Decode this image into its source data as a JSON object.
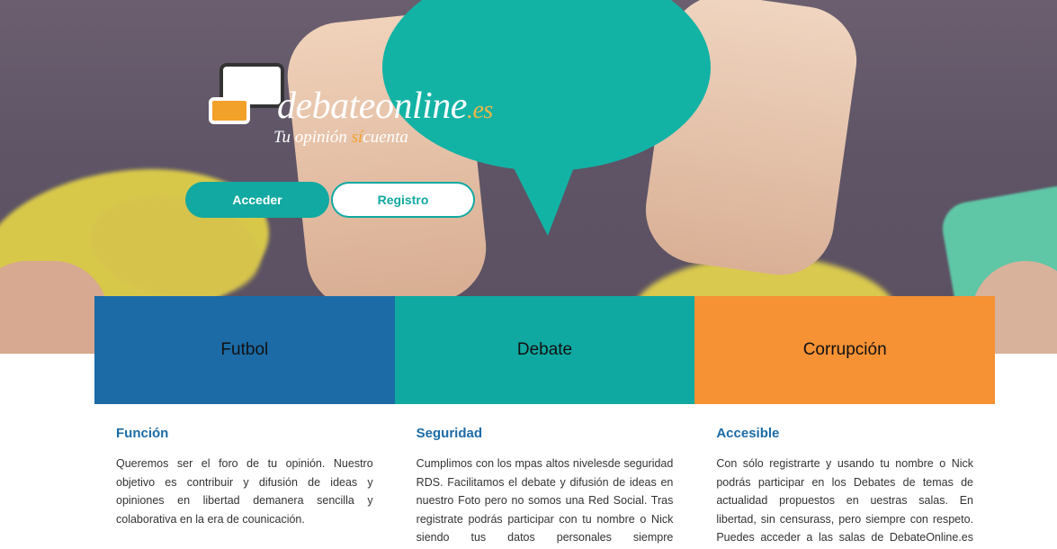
{
  "brand": {
    "name": "debateonline",
    "tld": ".es",
    "tagline_part1": "Tu opinión ",
    "tagline_highlight": "sí",
    "tagline_part2": "cuenta"
  },
  "hero_buttons": {
    "login_label": "Acceder",
    "register_label": "Registro"
  },
  "categories": [
    {
      "label": "Futbol",
      "color": "#1c6ba7"
    },
    {
      "label": "Debate",
      "color": "#0fa9a1"
    },
    {
      "label": "Corrupción",
      "color": "#f69134"
    }
  ],
  "features": [
    {
      "title": "Función",
      "text": "Queremos ser el foro de tu opinión. Nuestro objetivo es contribuir y difusión de ideas y opiniones en libertad demanera sencilla y colaborativa en la era de counicación."
    },
    {
      "title": "Seguridad",
      "text": "Cumplimos con los mpas altos nivelesde seguridad RDS. Facilitamos el debate y difusión de ideas en nuestro Foto pero no somos una Red Social. Tras registrate podrás participar con tu nombre o Nick siendo tus datos personales siempre confidenciales."
    },
    {
      "title": "Accesible",
      "text": "Con sólo registrarte y usando tu nombre o Nick podrás participar en los Debates de temas de actualidad propuestos en uestras salas. En libertad, sin censurass, pero siempre con respeto. Puedes acceder a las salas de DebateOnline.es desde tu móvil, Tablet o Pc."
    }
  ],
  "colors": {
    "primary_teal": "#11a9a1",
    "primary_blue": "#1c6ba7",
    "accent_orange": "#f69134"
  }
}
